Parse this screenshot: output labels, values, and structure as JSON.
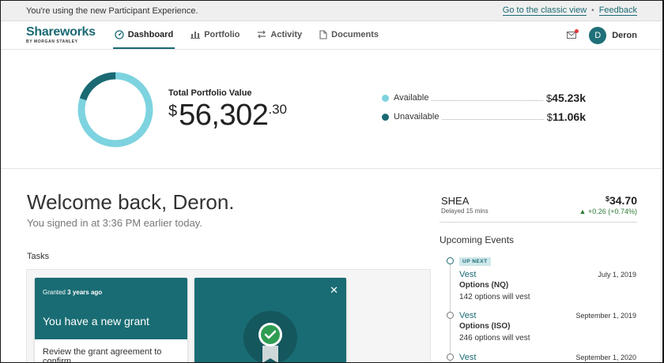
{
  "banner": {
    "message": "You're using the new Participant Experience.",
    "classic_link": "Go to the classic view",
    "separator": "•",
    "feedback_link": "Feedback"
  },
  "nav": {
    "logo_main": "Shareworks",
    "logo_sub": "BY MORGAN STANLEY",
    "items": [
      {
        "label": "Dashboard",
        "icon": "dashboard-icon",
        "active": true
      },
      {
        "label": "Portfolio",
        "icon": "bar-chart-icon",
        "active": false
      },
      {
        "label": "Activity",
        "icon": "swap-arrows-icon",
        "active": false
      },
      {
        "label": "Documents",
        "icon": "document-icon",
        "active": false
      }
    ],
    "user_initial": "D",
    "user_name": "Deron"
  },
  "portfolio": {
    "label": "Total Portfolio Value",
    "currency": "$",
    "value_main": "56,302",
    "value_cents": ".30",
    "available_fraction": 0.8,
    "legend": [
      {
        "label": "Available",
        "currency": "$",
        "amount": "45.23k",
        "color": "#7dd3df"
      },
      {
        "label": "Unavailable",
        "currency": "$",
        "amount": "11.06k",
        "color": "#1b6a73"
      }
    ]
  },
  "welcome": {
    "title": "Welcome back, Deron.",
    "subtitle": "You signed in at 3:36 PM earlier today."
  },
  "tasks": {
    "title": "Tasks",
    "card1": {
      "meta_prefix": "Granted ",
      "meta_bold": "3 years ago",
      "title": "You have a new grant",
      "body": "Review the grant agreement to confirm"
    },
    "card2": {
      "close": "✕"
    }
  },
  "stock": {
    "symbol": "SHEA",
    "delay": "Delayed 15 mins",
    "currency": "$",
    "price": "34.70",
    "change": "▲ +0.26 (+0.74%)"
  },
  "events": {
    "title": "Upcoming Events",
    "up_next": "UP NEXT",
    "items": [
      {
        "title": "Vest",
        "date": "July 1, 2019",
        "type": "Options (NQ)",
        "desc": "142 options will vest"
      },
      {
        "title": "Vest",
        "date": "September 1, 2019",
        "type": "Options (ISO)",
        "desc": "246 options will vest"
      },
      {
        "title": "Vest",
        "date": "September 1, 2020",
        "type": "",
        "desc": ""
      }
    ]
  },
  "colors": {
    "brand": "#1b6a73",
    "available": "#7dd3df",
    "positive": "#2c7a34"
  }
}
